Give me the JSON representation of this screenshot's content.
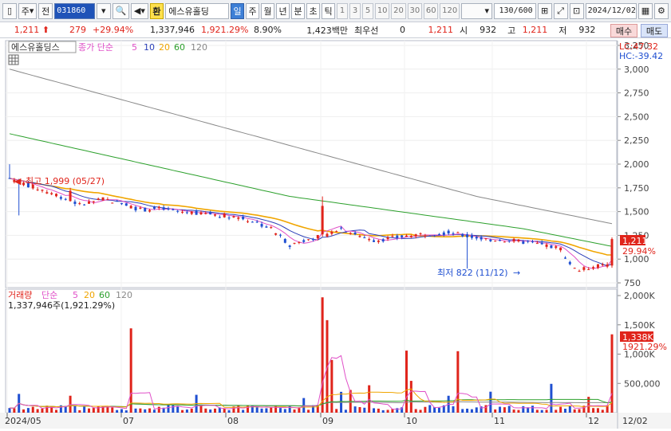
{
  "toolbar": {
    "menu_label": "주",
    "jeon_label": "전",
    "stock_code": "031860",
    "stock_name": "에스유홀딩",
    "hwan_label": "환",
    "periods": [
      "일",
      "주",
      "월",
      "년",
      "분",
      "초",
      "틱"
    ],
    "active_period": "일",
    "nums": [
      "1",
      "3",
      "5",
      "10",
      "20",
      "30",
      "60",
      "120"
    ],
    "count": "130/600",
    "date": "2024/12/02"
  },
  "pricebar": {
    "price": "1,211",
    "change": "279",
    "change_pct": "+29.94%",
    "volume": "1,337,946",
    "volume_pct": "1,921.29%",
    "turnover": "8.90%",
    "amount": "1,423백만",
    "prefer_label": "최우선",
    "prefer_value": "0",
    "prefer_price": "1,211",
    "open_label": "시",
    "open_value": "932",
    "high_label": "고",
    "high_value": "1,211",
    "low_label": "저",
    "low_value": "932",
    "buy_label": "매수",
    "sell_label": "매도"
  },
  "price_panel": {
    "legend_name": "에스유홀딩스",
    "legend_type": "종가 단순",
    "ma_periods": [
      "5",
      "10",
      "20",
      "60",
      "120"
    ],
    "lc_label": "LC:47.32",
    "hc_label": "HC:-39.42",
    "y_ticks": [
      "3,250",
      "3,000",
      "2,750",
      "2,500",
      "2,250",
      "2,000",
      "1,750",
      "1,500",
      "1,250",
      "1,000",
      "750"
    ],
    "high_annotation": "최고 1,999 (05/27)",
    "low_annotation": "최저 822 (11/12)",
    "price_tag": "1,211",
    "pct_tag": "29.94%"
  },
  "volume_panel": {
    "legend_name": "거래량",
    "legend_type": "단순",
    "ma_periods": [
      "5",
      "20",
      "60",
      "120"
    ],
    "vol_text": "1,337,946주(1,921.29%)",
    "y_ticks": [
      "2,000K",
      "1,500K",
      "1,000K",
      "500,000"
    ],
    "vol_tag": "1,338K",
    "vol_pct_tag": "1921.29%"
  },
  "x_ticks": [
    "2024/05",
    "07",
    "08",
    "09",
    "10",
    "11",
    "12"
  ],
  "x_right_label": "12/02",
  "colors": {
    "up": "#e0241b",
    "down": "#1f4fd1",
    "ma5": "#e050c8",
    "ma10": "#2b3fb8",
    "ma20": "#f0a500",
    "ma60": "#2ca02c",
    "ma120": "#888888"
  },
  "chart_data": {
    "type": "candlestick",
    "price_ylim": [
      700,
      3300
    ],
    "volume_ylim": [
      0,
      2000000
    ],
    "x_start_label": "2024/05",
    "series": [
      {
        "name": "5",
        "kind": "ma"
      },
      {
        "name": "10",
        "kind": "ma"
      },
      {
        "name": "20",
        "kind": "ma"
      },
      {
        "name": "60",
        "kind": "ma"
      },
      {
        "name": "120",
        "kind": "ma"
      }
    ],
    "last_close": 1211,
    "last_volume": 1337946
  }
}
